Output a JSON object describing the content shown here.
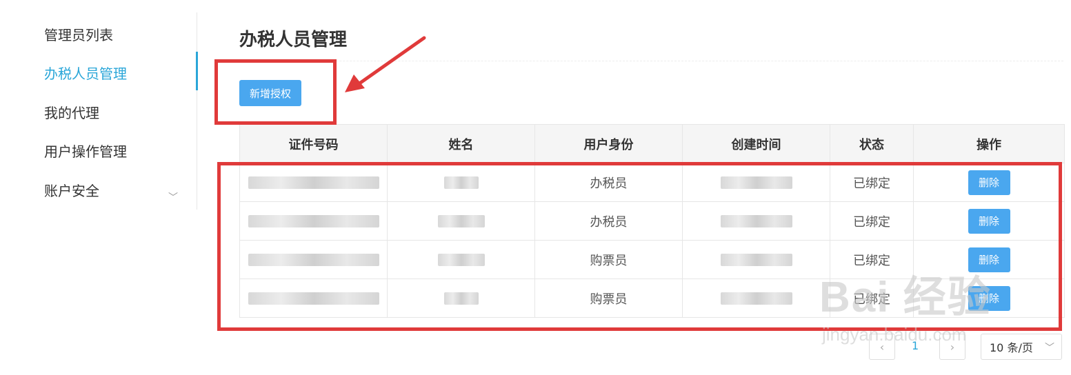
{
  "sidebar": {
    "items": [
      {
        "label": "管理员列表"
      },
      {
        "label": "办税人员管理"
      },
      {
        "label": "我的代理"
      },
      {
        "label": "用户操作管理"
      },
      {
        "label": "账户安全"
      }
    ],
    "expand_icon": "chevron-down-icon"
  },
  "main": {
    "title": "办税人员管理",
    "add_button": "新增授权"
  },
  "table": {
    "headers": [
      "证件号码",
      "姓名",
      "用户身份",
      "创建时间",
      "状态",
      "操作"
    ],
    "rows": [
      {
        "role": "办税员",
        "status": "已绑定",
        "action": "删除"
      },
      {
        "role": "办税员",
        "status": "已绑定",
        "action": "删除"
      },
      {
        "role": "购票员",
        "status": "已绑定",
        "action": "删除"
      },
      {
        "role": "购票员",
        "status": "已绑定",
        "action": "删除"
      }
    ]
  },
  "pagination": {
    "current_page": "1",
    "page_size": "10 条/页"
  },
  "watermark": {
    "main": "Bai 经验",
    "sub": "jingyan.baidu.com"
  },
  "annotation_colors": {
    "red": "#e03a3a",
    "accent": "#2aa6d8",
    "button": "#4aa7ef"
  }
}
